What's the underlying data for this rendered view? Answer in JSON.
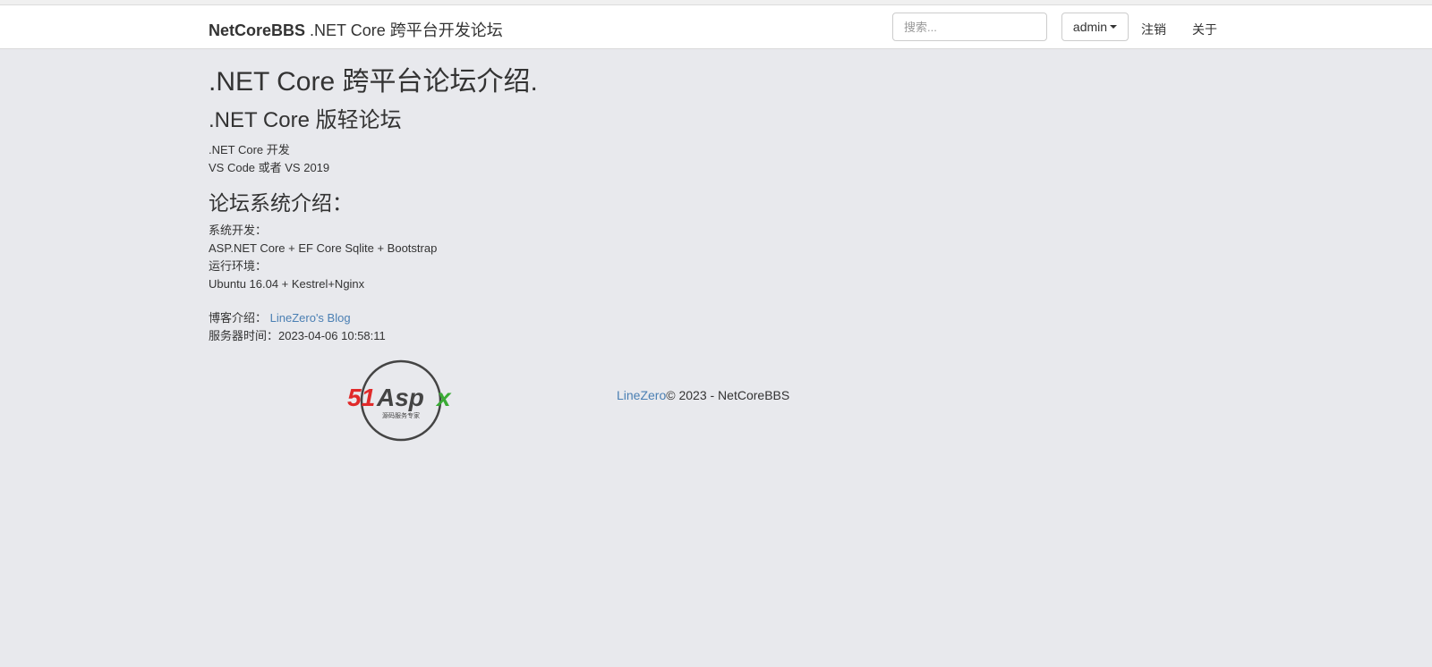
{
  "navbar": {
    "brand_name": "NetCoreBBS",
    "brand_tagline": " .NET Core 跨平台开发论坛",
    "search_placeholder": "搜索...",
    "user_label": "admin",
    "logout_label": "注销",
    "about_label": "关于"
  },
  "main": {
    "title": ".NET Core 跨平台论坛介绍.",
    "subtitle": ".NET Core 版轻论坛",
    "dev_lines": [
      ".NET Core 开发",
      "VS Code 或者 VS 2019"
    ],
    "system_title": "论坛系统介绍：",
    "system_lines": [
      "系统开发：",
      "ASP.NET Core + EF Core Sqlite + Bootstrap",
      "运行环境：",
      "Ubuntu 16.04 + Kestrel+Nginx"
    ],
    "blog_label": "博客介绍：",
    "blog_link": "LineZero's Blog",
    "server_time_label": "服务器时间：",
    "server_time": "2023-04-06 10:58:11"
  },
  "logo": {
    "brand_red": "51",
    "brand_dark": "Asp",
    "brand_green": "x",
    "caption": "源码服务专家",
    "colors": {
      "red": "#e02a2a",
      "dark": "#444444",
      "green": "#3aaa35"
    }
  },
  "footer": {
    "author_link": "LineZero",
    "copyright": "© 2023 - NetCoreBBS"
  }
}
